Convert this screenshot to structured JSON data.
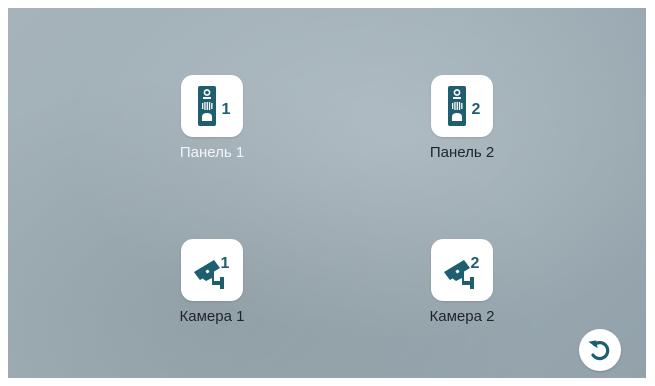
{
  "colors": {
    "accent": "#1f5e6e",
    "tile_bg": "#ffffff",
    "background": "#9fadb5"
  },
  "tiles": [
    {
      "label": "Панель 1",
      "number": "1",
      "icon": "door-panel-icon"
    },
    {
      "label": "Панель 2",
      "number": "2",
      "icon": "door-panel-icon"
    },
    {
      "label": "Камера 1",
      "number": "1",
      "icon": "cctv-camera-icon"
    },
    {
      "label": "Камера 2",
      "number": "2",
      "icon": "cctv-camera-icon"
    }
  ],
  "back_button": {
    "icon": "back-rotate-icon"
  }
}
